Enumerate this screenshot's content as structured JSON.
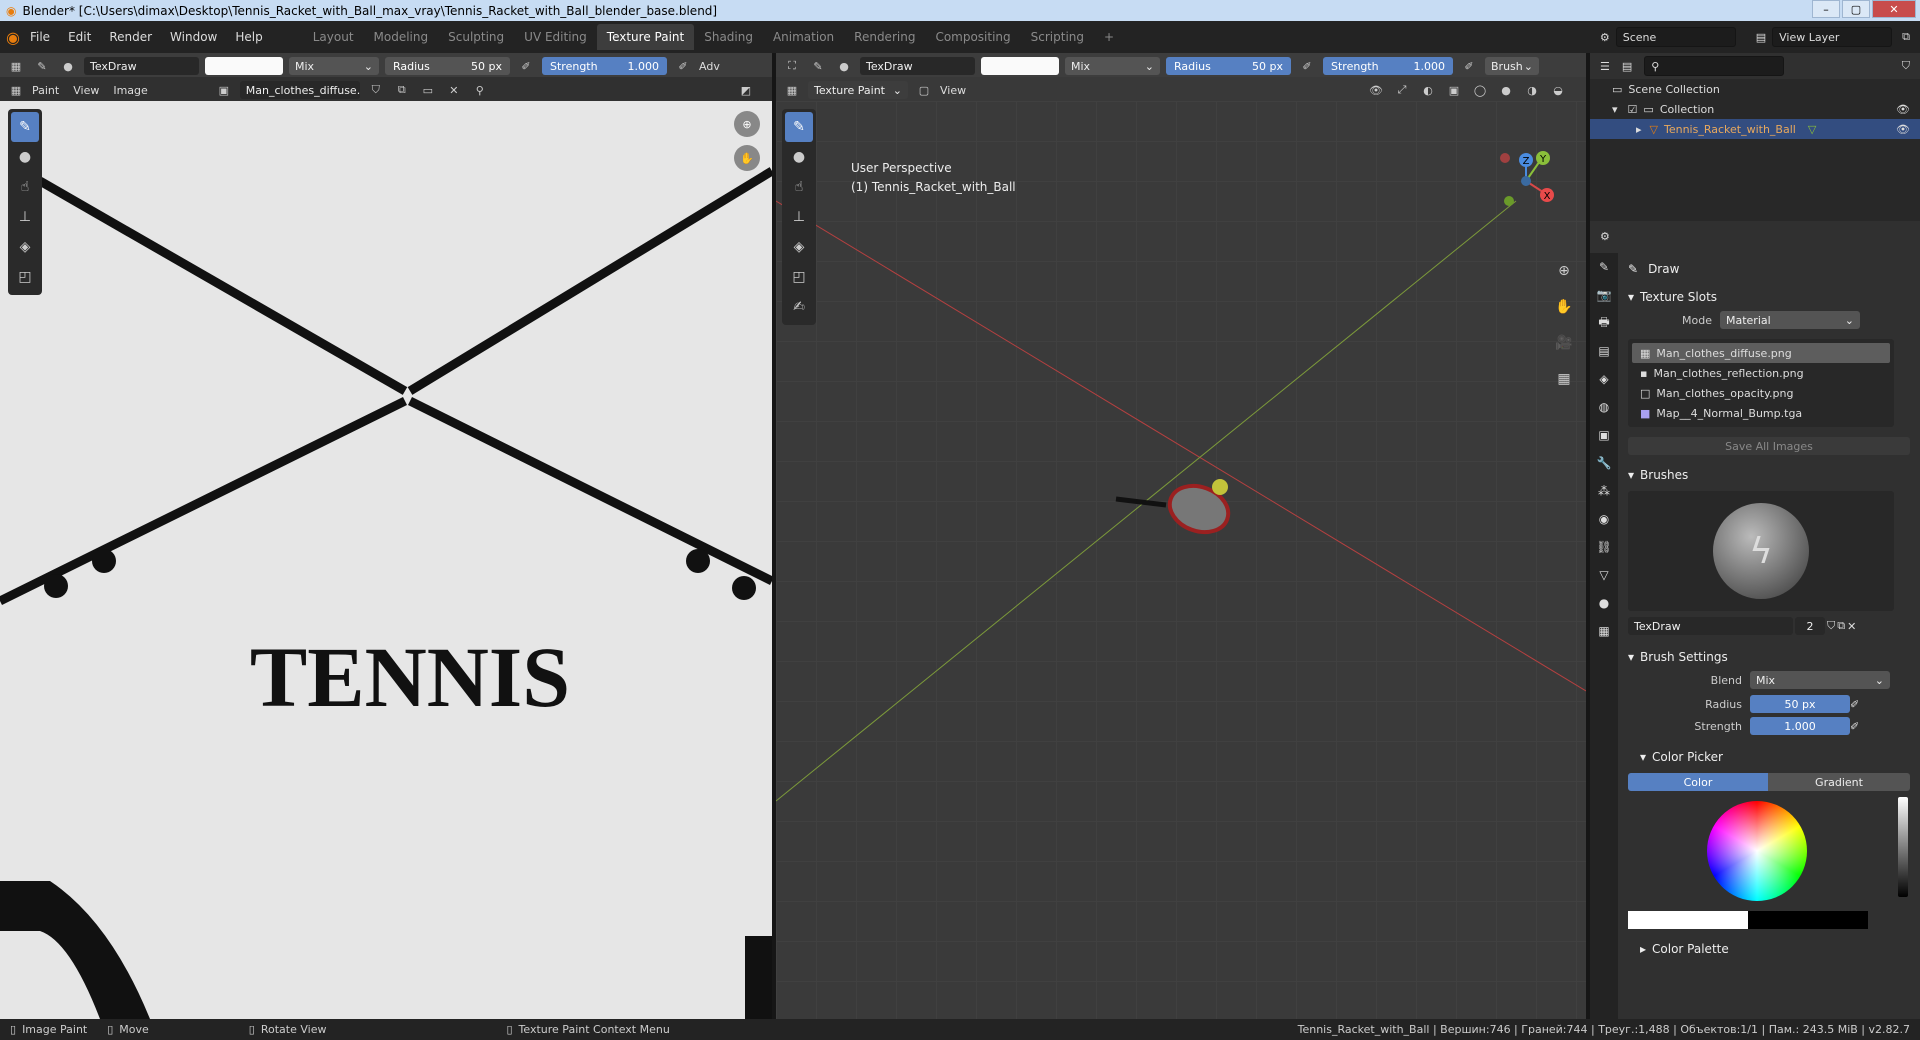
{
  "window": {
    "title": "Blender* [C:\\Users\\dimax\\Desktop\\Tennis_Racket_with_Ball_max_vray\\Tennis_Racket_with_Ball_blender_base.blend]"
  },
  "menu": [
    "File",
    "Edit",
    "Render",
    "Window",
    "Help"
  ],
  "workspaces": [
    "Layout",
    "Modeling",
    "Sculpting",
    "UV Editing",
    "Texture Paint",
    "Shading",
    "Animation",
    "Rendering",
    "Compositing",
    "Scripting"
  ],
  "active_workspace": "Texture Paint",
  "scene": "Scene",
  "view_layer": "View Layer",
  "image_editor": {
    "brush_name": "TexDraw",
    "blend": "Mix",
    "radius_label": "Radius",
    "radius": "50 px",
    "strength_label": "Strength",
    "strength": "1.000",
    "adv": "Adv",
    "mode": "Paint",
    "view": "View",
    "image_menu": "Image",
    "image_name": "Man_clothes_diffuse.",
    "texture_text": "TENNIS"
  },
  "viewport": {
    "brush_name": "TexDraw",
    "blend": "Mix",
    "radius_label": "Radius",
    "radius": "50 px",
    "strength_label": "Strength",
    "strength": "1.000",
    "brush_menu": "Brush",
    "mode": "Texture Paint",
    "view": "View",
    "perspective": "User Perspective",
    "object_label": "(1) Tennis_Racket_with_Ball",
    "axes": {
      "x": "X",
      "y": "Y",
      "z": "Z"
    }
  },
  "outliner": {
    "scene_collection": "Scene Collection",
    "collection": "Collection",
    "object": "Tennis_Racket_with_Ball"
  },
  "properties": {
    "tool_name": "Draw",
    "texture_slots": "Texture Slots",
    "mode_label": "Mode",
    "mode_value": "Material",
    "slots": [
      "Man_clothes_diffuse.png",
      "Man_clothes_reflection.png",
      "Man_clothes_opacity.png",
      "Map__4_Normal_Bump.tga"
    ],
    "save_all": "Save All Images",
    "brushes": "Brushes",
    "brush_name": "TexDraw",
    "brush_users": "2",
    "brush_settings": "Brush Settings",
    "blend_label": "Blend",
    "blend_value": "Mix",
    "radius_label": "Radius",
    "radius_value": "50 px",
    "strength_label": "Strength",
    "strength_value": "1.000",
    "color_picker": "Color Picker",
    "color_tab": "Color",
    "gradient_tab": "Gradient",
    "color_palette": "Color Palette"
  },
  "status": {
    "image_paint": "Image Paint",
    "move": "Move",
    "rotate": "Rotate View",
    "context_menu": "Texture Paint Context Menu",
    "stats": "Tennis_Racket_with_Ball | Вершин:746 | Граней:744 | Треуг.:1,488 | Объектов:1/1 | Пам.: 243.5 MiB | v2.82.7"
  },
  "colors": {
    "accent": "#5680c2",
    "brand": "#e87d0d"
  }
}
